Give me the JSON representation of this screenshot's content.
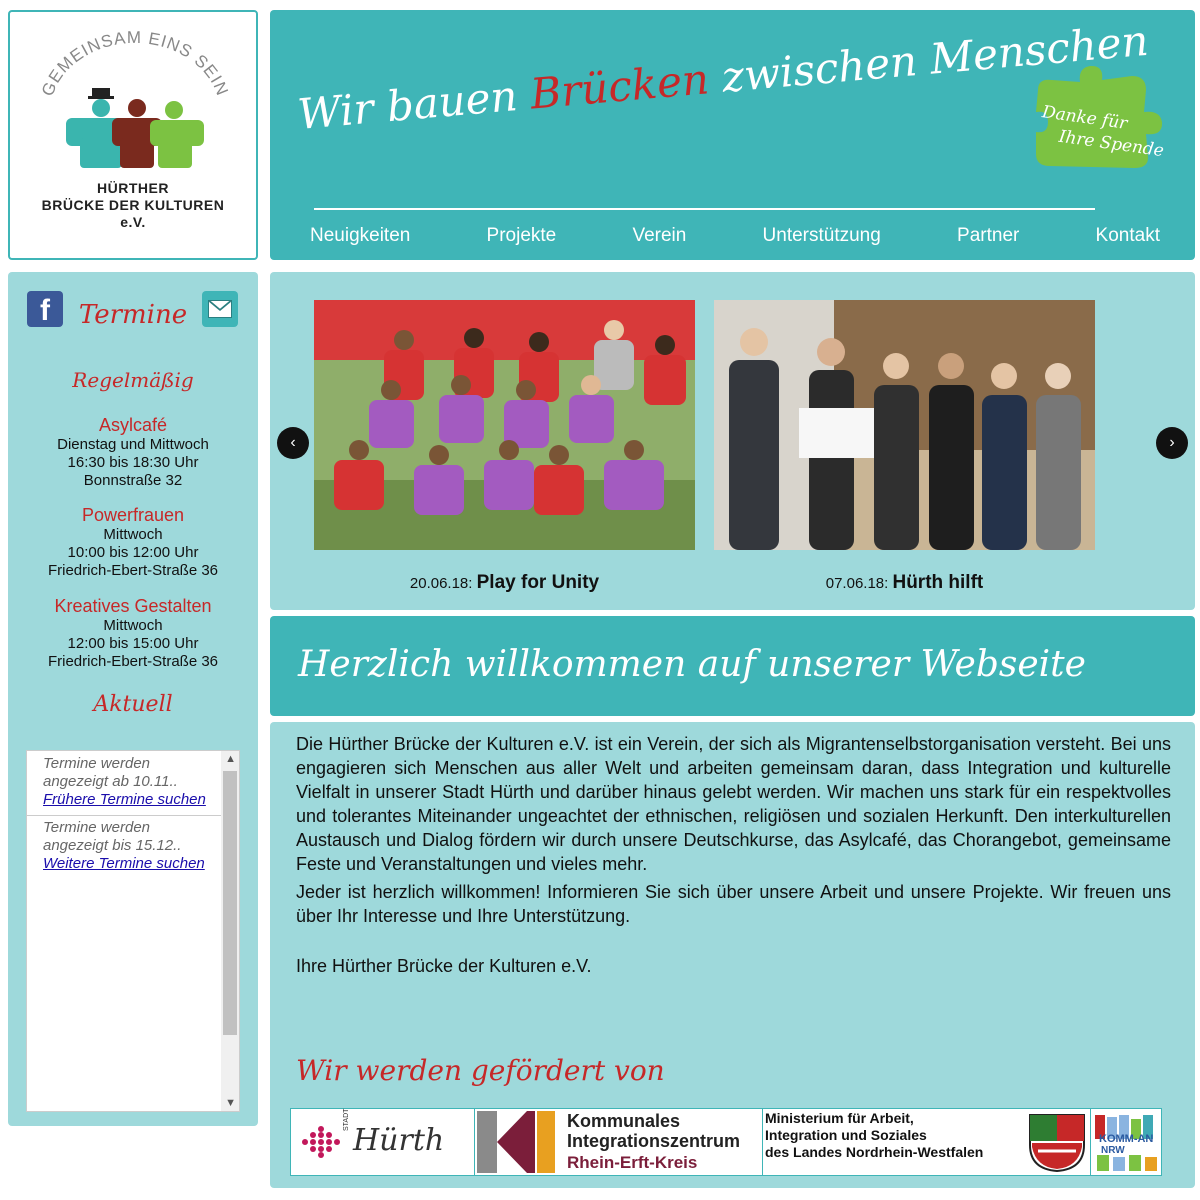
{
  "logo": {
    "arc_text": "GEMEINSAM EINS SEIN",
    "line1": "HÜRTHER",
    "line2": "BRÜCKE DER KULTUREN",
    "line3": "e.V."
  },
  "header": {
    "slogan_a": "Wir bauen",
    "slogan_b": "Brücken",
    "slogan_c": "zwischen Menschen",
    "donate_line1": "Danke für",
    "donate_line2": "Ihre Spende",
    "nav": [
      "Neuigkeiten",
      "Projekte",
      "Verein",
      "Unterstützung",
      "Partner",
      "Kontakt"
    ]
  },
  "sidebar": {
    "facebook_glyph": "f",
    "termine_title": "Termine",
    "regel_title": "Regelmäßig",
    "events": [
      {
        "title": "Asylcafé",
        "day": "Dienstag und Mittwoch",
        "time": "16:30 bis 18:30 Uhr",
        "place": "Bonnstraße 32"
      },
      {
        "title": "Powerfrauen",
        "day": "Mittwoch",
        "time": "10:00 bis 12:00 Uhr",
        "place": "Friedrich-Ebert-Straße 36"
      },
      {
        "title": "Kreatives Gestalten",
        "day": "Mittwoch",
        "time": "12:00 bis 15:00 Uhr",
        "place": "Friedrich-Ebert-Straße 36"
      }
    ],
    "aktuell_title": "Aktuell",
    "termbox": {
      "b1_text1": "Termine werden",
      "b1_text2": "angezeigt ab 10.11..",
      "b1_link": "Frühere Termine suchen",
      "b2_text1": "Termine werden",
      "b2_text2": "angezeigt bis 15.12..",
      "b2_link": "Weitere Termine suchen"
    }
  },
  "slider": {
    "prev": "‹",
    "next": "›",
    "items": [
      {
        "date": "20.06.18:",
        "title": "Play for Unity"
      },
      {
        "date": "07.06.18:",
        "title": "Hürth hilft"
      }
    ]
  },
  "welcome": {
    "title": "Herzlich willkommen auf unserer Webseite"
  },
  "content": {
    "p1": "Die Hürther Brücke der Kulturen e.V. ist ein Verein, der sich als Migrantenselbstorganisation versteht. Bei uns engagieren sich Menschen aus aller Welt und arbeiten gemeinsam daran, dass Integration und kulturelle Vielfalt in unserer Stadt Hürth und darüber hinaus gelebt werden. Wir machen uns stark für ein respektvolles und tolerantes Miteinander ungeachtet der ethnischen, religiösen und sozialen Herkunft. Den interkulturellen Austausch und Dialog fördern wir durch unsere Deutschkurse, das Asylcafé, das Chorangebot, gemeinsame Feste und Veranstaltungen und vieles mehr.",
    "p2": "Jeder ist herzlich willkommen! Informieren Sie sich über unsere Arbeit und unsere Projekte. Wir freuen uns über Ihr Interesse und Ihre Unterstützung.",
    "p3": "Ihre Hürther Brücke der Kulturen e.V.",
    "gefoerdert": "Wir werden gefördert von",
    "sponsors": {
      "huerth_small": "STADT",
      "huerth": "Hürth",
      "kiz1": "Kommunales",
      "kiz2": "Integrationszentrum",
      "kiz3": "Rhein-Erft-Kreis",
      "mais1": "Ministerium für Arbeit,",
      "mais2": "Integration und Soziales",
      "mais3": "des Landes Nordrhein-Westfalen",
      "komm1": "KOMM-AN",
      "komm2": "NRW"
    }
  }
}
